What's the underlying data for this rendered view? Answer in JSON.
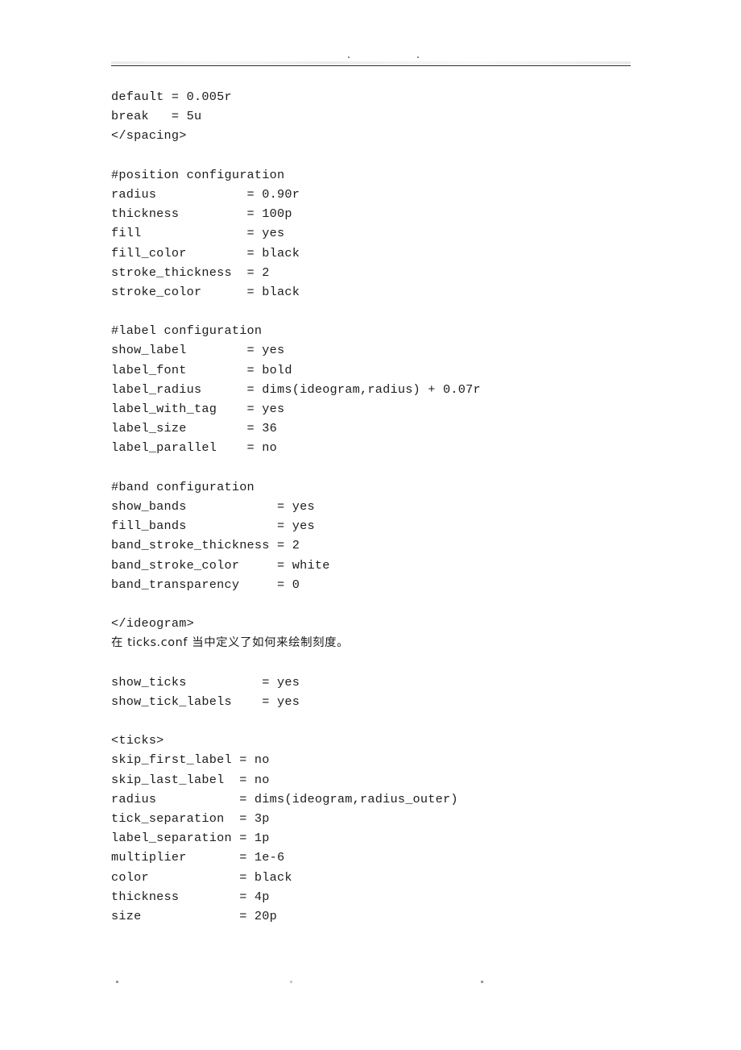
{
  "page": {
    "kind": "scanned-document-page",
    "header": {
      "rule_color": "#2b2b2b",
      "artifact_marks": [
        "speck",
        "speck"
      ]
    },
    "footer": {
      "artifact_marks": [
        "speck",
        "speck",
        "speck"
      ]
    }
  },
  "content": {
    "lines": [
      {
        "text": "default = 0.005r",
        "script": "latin"
      },
      {
        "text": "break   = 5u",
        "script": "latin"
      },
      {
        "text": "</spacing>",
        "script": "latin"
      },
      {
        "text": "",
        "script": "blank"
      },
      {
        "text": "#position configuration",
        "script": "latin"
      },
      {
        "text": "radius            = 0.90r",
        "script": "latin"
      },
      {
        "text": "thickness         = 100p",
        "script": "latin"
      },
      {
        "text": "fill              = yes",
        "script": "latin"
      },
      {
        "text": "fill_color        = black",
        "script": "latin"
      },
      {
        "text": "stroke_thickness  = 2",
        "script": "latin"
      },
      {
        "text": "stroke_color      = black",
        "script": "latin"
      },
      {
        "text": "",
        "script": "blank"
      },
      {
        "text": "#label configuration",
        "script": "latin"
      },
      {
        "text": "show_label        = yes",
        "script": "latin"
      },
      {
        "text": "label_font        = bold",
        "script": "latin"
      },
      {
        "text": "label_radius      = dims(ideogram,radius) + 0.07r",
        "script": "latin"
      },
      {
        "text": "label_with_tag    = yes",
        "script": "latin"
      },
      {
        "text": "label_size        = 36",
        "script": "latin"
      },
      {
        "text": "label_parallel    = no",
        "script": "latin"
      },
      {
        "text": "",
        "script": "blank"
      },
      {
        "text": "#band configuration",
        "script": "latin"
      },
      {
        "text": "show_bands            = yes",
        "script": "latin"
      },
      {
        "text": "fill_bands            = yes",
        "script": "latin"
      },
      {
        "text": "band_stroke_thickness = 2",
        "script": "latin"
      },
      {
        "text": "band_stroke_color     = white",
        "script": "latin"
      },
      {
        "text": "band_transparency     = 0",
        "script": "latin"
      },
      {
        "text": "",
        "script": "blank"
      },
      {
        "text": "</ideogram>",
        "script": "latin"
      },
      {
        "text": "在 ticks.conf 当中定义了如何来绘制刻度。",
        "script": "cjk"
      },
      {
        "text": "",
        "script": "blank"
      },
      {
        "text": "show_ticks          = yes",
        "script": "latin"
      },
      {
        "text": "show_tick_labels    = yes",
        "script": "latin"
      },
      {
        "text": "",
        "script": "blank"
      },
      {
        "text": "<ticks>",
        "script": "latin"
      },
      {
        "text": "skip_first_label = no",
        "script": "latin"
      },
      {
        "text": "skip_last_label  = no",
        "script": "latin"
      },
      {
        "text": "radius           = dims(ideogram,radius_outer)",
        "script": "latin"
      },
      {
        "text": "tick_separation  = 3p",
        "script": "latin"
      },
      {
        "text": "label_separation = 1p",
        "script": "latin"
      },
      {
        "text": "multiplier       = 1e-6",
        "script": "latin"
      },
      {
        "text": "color            = black",
        "script": "latin"
      },
      {
        "text": "thickness        = 4p",
        "script": "latin"
      },
      {
        "text": "size             = 20p",
        "script": "latin"
      }
    ]
  }
}
